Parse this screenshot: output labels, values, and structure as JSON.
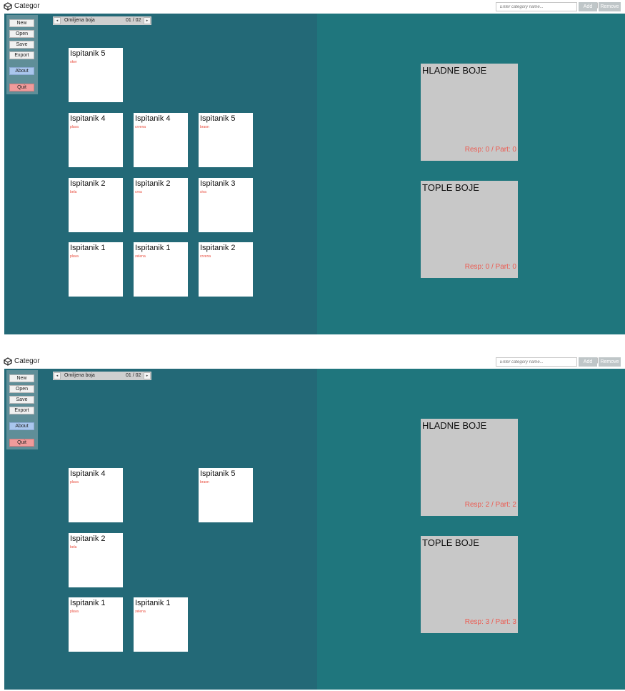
{
  "colors": {
    "left_pane": "#236977",
    "right_pane": "#1f767d",
    "sidebar": "#5f8e98",
    "about_button": "#a9c6ed",
    "quit_button": "#ef9b9b",
    "card_value_text": "#e84b3c",
    "category_box": "#c8c8c8",
    "category_stats_text": "#ec5a50"
  },
  "windows": [
    {
      "title": "Categor",
      "window_controls": {
        "minimize": "—",
        "restore": "❐",
        "close": "✕"
      },
      "sidebar": {
        "new": "New",
        "open": "Open",
        "save": "Save",
        "export": "Export",
        "about": "About",
        "quit": "Quit"
      },
      "question_nav": {
        "prev": "◂",
        "next": "▸",
        "question": "Omiljena boja",
        "counter": "01 / 02"
      },
      "category_input": {
        "placeholder": "Enter category name...",
        "add": "Add",
        "remove": "Remove"
      },
      "cards": [
        {
          "name": "Ispitanik 5",
          "value": "oker"
        },
        {
          "name": "Ispitanik 4",
          "value": "plava"
        },
        {
          "name": "Ispitanik 4",
          "value": "crvena"
        },
        {
          "name": "Ispitanik 5",
          "value": "braon"
        },
        {
          "name": "Ispitanik 2",
          "value": "bela"
        },
        {
          "name": "Ispitanik 2",
          "value": "crna"
        },
        {
          "name": "Ispitanik 3",
          "value": "siva"
        },
        {
          "name": "Ispitanik 1",
          "value": "plava"
        },
        {
          "name": "Ispitanik 1",
          "value": "zelena"
        },
        {
          "name": "Ispitanik 2",
          "value": "crvena"
        }
      ],
      "categories": [
        {
          "title": "HLADNE BOJE",
          "stats": "Resp: 0 / Part: 0"
        },
        {
          "title": "TOPLE BOJE",
          "stats": "Resp: 0 / Part: 0"
        }
      ]
    },
    {
      "title": "Categor",
      "window_controls": {
        "minimize": "—",
        "restore": "❐",
        "close": "✕"
      },
      "sidebar": {
        "new": "New",
        "open": "Open",
        "save": "Save",
        "export": "Export",
        "about": "About",
        "quit": "Quit"
      },
      "question_nav": {
        "prev": "◂",
        "next": "▸",
        "question": "Omiljena boja",
        "counter": "01 / 02"
      },
      "category_input": {
        "placeholder": "Enter category name...",
        "add": "Add",
        "remove": "Remove"
      },
      "cards": [
        {
          "name": "Ispitanik 4",
          "value": "plava"
        },
        {
          "name": "Ispitanik 5",
          "value": "braon"
        },
        {
          "name": "Ispitanik 2",
          "value": "bela"
        },
        {
          "name": "Ispitanik 1",
          "value": "plava"
        },
        {
          "name": "Ispitanik 1",
          "value": "zelena"
        }
      ],
      "categories": [
        {
          "title": "HLADNE BOJE",
          "stats": "Resp: 2 / Part: 2"
        },
        {
          "title": "TOPLE BOJE",
          "stats": "Resp: 3 / Part: 3"
        }
      ]
    }
  ]
}
